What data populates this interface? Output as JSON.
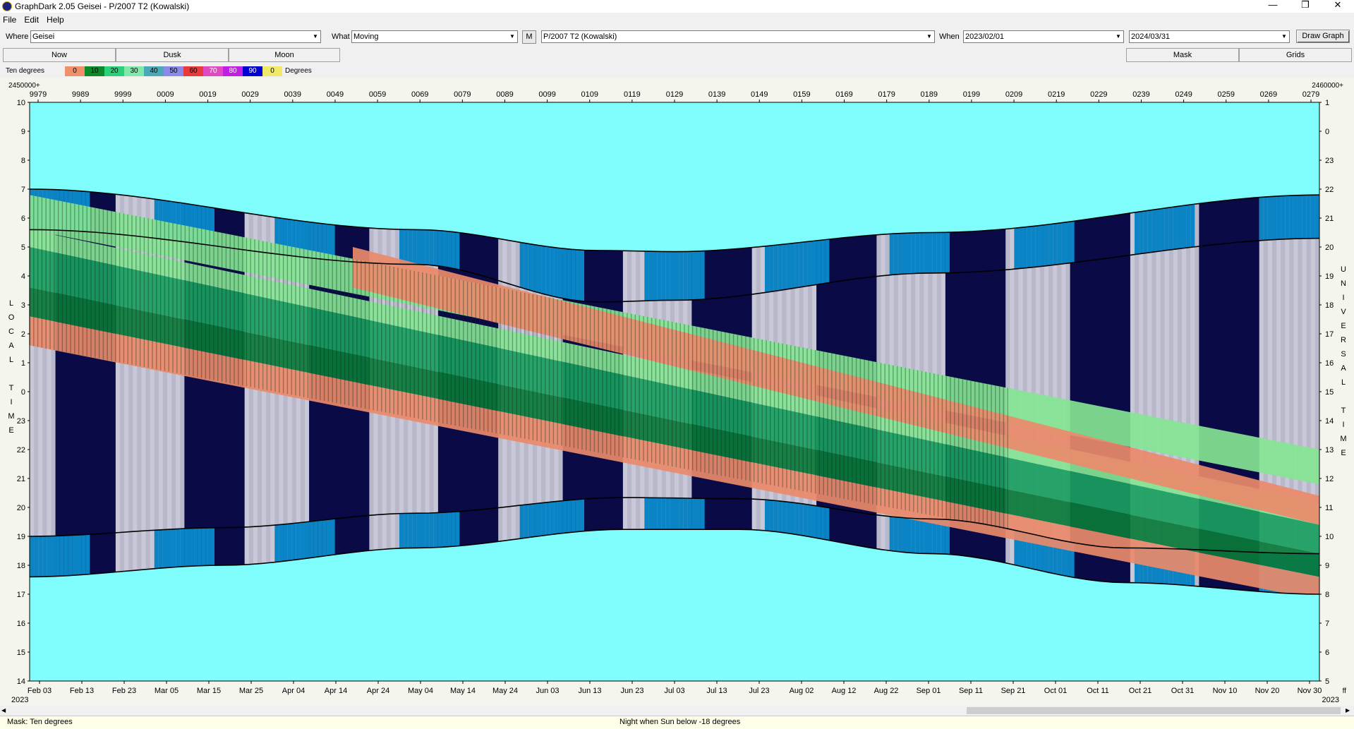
{
  "window": {
    "title": "GraphDark 2.05  Geisei  -  P/2007 T2 (Kowalski)",
    "minimize": "—",
    "restore": "❐",
    "close": "✕"
  },
  "menu": [
    "File",
    "Edit",
    "Help"
  ],
  "toolbar": {
    "where_label": "Where",
    "where_value": "Geisei",
    "what_label": "What",
    "what_value": "Moving",
    "m_button": "M",
    "object_value": "P/2007 T2 (Kowalski)",
    "when_label": "When",
    "start_date": "2023/02/01",
    "end_date": "2024/03/31",
    "draw_button": "Draw Graph"
  },
  "tabs": {
    "now": "Now",
    "dusk": "Dusk",
    "moon": "Moon",
    "mask": "Mask",
    "grids": "Grids"
  },
  "legend": {
    "label": "Ten degrees",
    "items": [
      {
        "text": "0",
        "color": "#f0906a"
      },
      {
        "text": "10",
        "color": "#0a8a2a"
      },
      {
        "text": "20",
        "color": "#2bd17a"
      },
      {
        "text": "30",
        "color": "#80e8a8"
      },
      {
        "text": "40",
        "color": "#4aa8b8"
      },
      {
        "text": "50",
        "color": "#8a8ae8"
      },
      {
        "text": "60",
        "color": "#e83a3a"
      },
      {
        "text": "70",
        "color": "#e04ac0"
      },
      {
        "text": "80",
        "color": "#c020e0"
      },
      {
        "text": "90",
        "color": "#0000d0"
      },
      {
        "text": "0",
        "color": "#f0e868"
      }
    ],
    "units": "Degrees"
  },
  "chart": {
    "jd_left_prefix": "2450000+",
    "jd_right_prefix": "2460000+",
    "jd_ticks": [
      "9979",
      "9989",
      "9999",
      "0009",
      "0019",
      "0029",
      "0039",
      "0049",
      "0059",
      "0069",
      "0079",
      "0089",
      "0099",
      "0109",
      "0119",
      "0129",
      "0139",
      "0149",
      "0159",
      "0169",
      "0179",
      "0189",
      "0199",
      "0209",
      "0219",
      "0229",
      "0239",
      "0249",
      "0259",
      "0269",
      "0279"
    ],
    "date_ticks": [
      "Feb 03",
      "Feb 13",
      "Feb 23",
      "Mar 05",
      "Mar 15",
      "Mar 25",
      "Apr 04",
      "Apr 14",
      "Apr 24",
      "May 04",
      "May 14",
      "May 24",
      "Jun 03",
      "Jun 13",
      "Jun 23",
      "Jul 03",
      "Jul 13",
      "Jul 23",
      "Aug 02",
      "Aug 12",
      "Aug 22",
      "Sep 01",
      "Sep 11",
      "Sep 21",
      "Oct 01",
      "Oct 11",
      "Oct 21",
      "Oct 31",
      "Nov 10",
      "Nov 20",
      "Nov 30"
    ],
    "year_left": "2023",
    "year_right": "2023",
    "right_extra": "ff",
    "left_axis_ticks": [
      "10",
      "9",
      "8",
      "7",
      "6",
      "5",
      "4",
      "3",
      "2",
      "1",
      "0",
      "23",
      "22",
      "21",
      "20",
      "19",
      "18",
      "17",
      "16",
      "15",
      "14"
    ],
    "right_axis_ticks": [
      "1",
      "0",
      "23",
      "22",
      "21",
      "20",
      "19",
      "18",
      "17",
      "16",
      "15",
      "14",
      "13",
      "12",
      "11",
      "10",
      "9",
      "8",
      "7",
      "6",
      "5"
    ],
    "left_axis_title": [
      "L",
      "O",
      "C",
      "A",
      "L",
      "",
      "T",
      "I",
      "M",
      "E"
    ],
    "right_axis_title": [
      "U",
      "N",
      "I",
      "V",
      "E",
      "R",
      "S",
      "A",
      "L",
      "",
      "T",
      "I",
      "M",
      "E"
    ],
    "colors": {
      "day_sky": "#7ffcfc",
      "night": "#0a0a46",
      "moonlit": "#c8c8d8",
      "twilight_blue": "#0a84c4",
      "comet_salmon": "#ea8a6a",
      "comet_dark_green": "#0a7a3a",
      "comet_green": "#1aa060",
      "comet_light_green": "#86e494",
      "comet_red": "#e0402a"
    }
  },
  "status": {
    "mask_text": "Mask:  Ten degrees",
    "night_text": "Night when Sun below -18 degrees"
  }
}
